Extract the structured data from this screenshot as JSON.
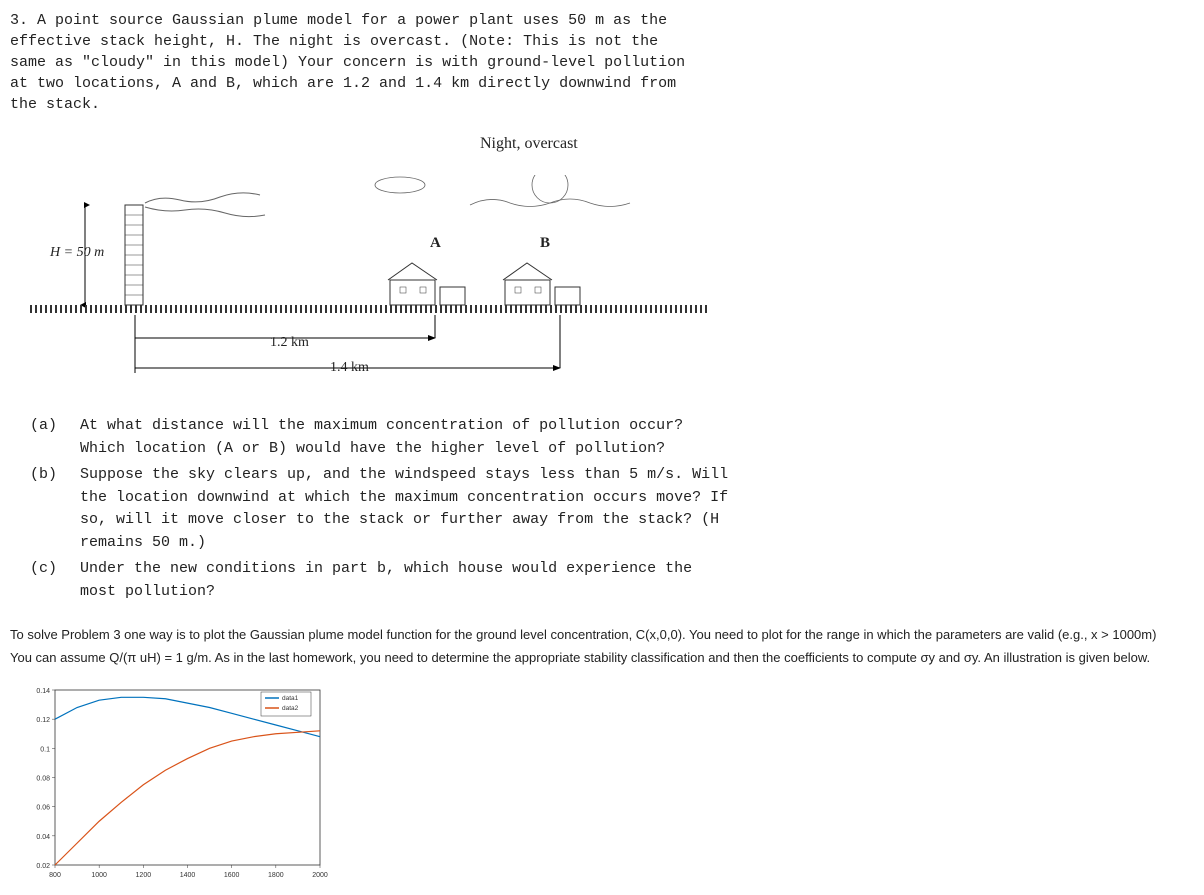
{
  "problem": {
    "number": "3.",
    "text": "A point source Gaussian plume model for a power plant uses 50 m as the effective stack height, H. The night is overcast. (Note: This is not the same as \"cloudy\" in this model) Your concern is with ground-level pollution at two locations, A and B, which are 1.2 and 1.4 km directly downwind from the stack."
  },
  "diagram": {
    "night_label": "Night, overcast",
    "height_label": "H = 50 m",
    "house_a": "A",
    "house_b": "B",
    "distance_12": "1.2 km",
    "distance_14": "1.4 km"
  },
  "questions": {
    "a": {
      "label": "(a)",
      "text": "At what distance will the maximum concentration of pollution occur? Which location (A or B) would have the higher level of pollution?"
    },
    "b": {
      "label": "(b)",
      "text": "Suppose the sky clears up, and the windspeed stays less than 5 m/s. Will the location downwind at which the maximum concentration occurs move? If so, will it move closer to the stack or further away from the stack? (H remains 50 m.)"
    },
    "c": {
      "label": "(c)",
      "text": "Under the new conditions in part b, which house would experience the most pollution?"
    }
  },
  "instructions": {
    "line1": "To solve Problem 3 one way is to plot the Gaussian plume model function for the ground level concentration, C(x,0,0). You need to plot for the range in which the parameters are valid (e.g., x > 1000m)",
    "line2": "You can assume Q/(π uH) = 1 g/m. As in the last homework, you need to determine the appropriate stability classification and then the coefficients to compute σy and σy. An illustration is given below."
  },
  "chart_data": {
    "type": "line",
    "xlabel": "",
    "ylabel": "",
    "xlim": [
      800,
      2000
    ],
    "ylim": [
      0.02,
      0.14
    ],
    "xticks": [
      800,
      1000,
      1200,
      1400,
      1600,
      1800,
      2000
    ],
    "yticks": [
      0.02,
      0.04,
      0.06,
      0.08,
      0.1,
      0.12,
      0.14
    ],
    "legend": [
      "data1",
      "data2"
    ],
    "series": [
      {
        "name": "data1",
        "color": "#0072BD",
        "x": [
          800,
          900,
          1000,
          1100,
          1200,
          1300,
          1400,
          1500,
          1600,
          1700,
          1800,
          1900,
          2000
        ],
        "y": [
          0.12,
          0.128,
          0.133,
          0.135,
          0.135,
          0.134,
          0.131,
          0.128,
          0.124,
          0.12,
          0.116,
          0.112,
          0.108
        ]
      },
      {
        "name": "data2",
        "color": "#D95319",
        "x": [
          800,
          900,
          1000,
          1100,
          1200,
          1300,
          1400,
          1500,
          1600,
          1700,
          1800,
          1900,
          2000
        ],
        "y": [
          0.02,
          0.035,
          0.05,
          0.063,
          0.075,
          0.085,
          0.093,
          0.1,
          0.105,
          0.108,
          0.11,
          0.111,
          0.112
        ]
      }
    ]
  }
}
